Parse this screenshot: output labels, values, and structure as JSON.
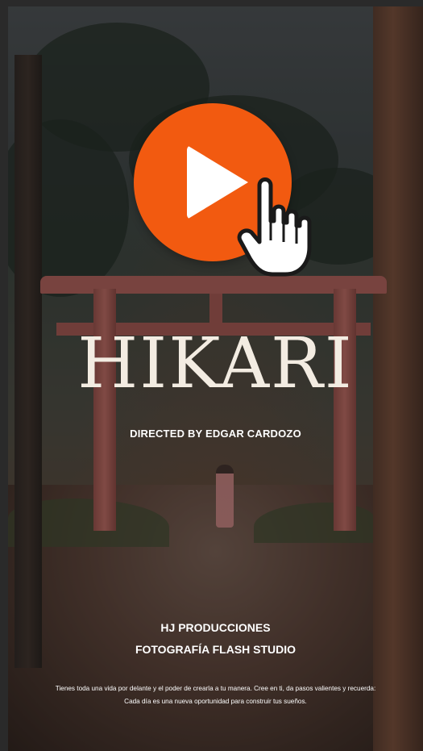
{
  "poster": {
    "title": "HIKARI",
    "directed_by": "DIRECTED BY EDGAR CARDOZO",
    "credit_1": "HJ PRODUCCIONES",
    "credit_2": "FOTOGRAFÍA FLASH STUDIO",
    "quote_line_1": "Tienes toda una vida por delante y el poder de crearla a tu manera. Cree en ti, da pasos valientes y recuerda:",
    "quote_line_2": "Cada día es una nueva oportunidad para construir tus sueños."
  },
  "play_button": {
    "icon": "play-icon",
    "color": "#f25a10"
  },
  "cursor": {
    "icon": "hand-pointer-icon"
  }
}
